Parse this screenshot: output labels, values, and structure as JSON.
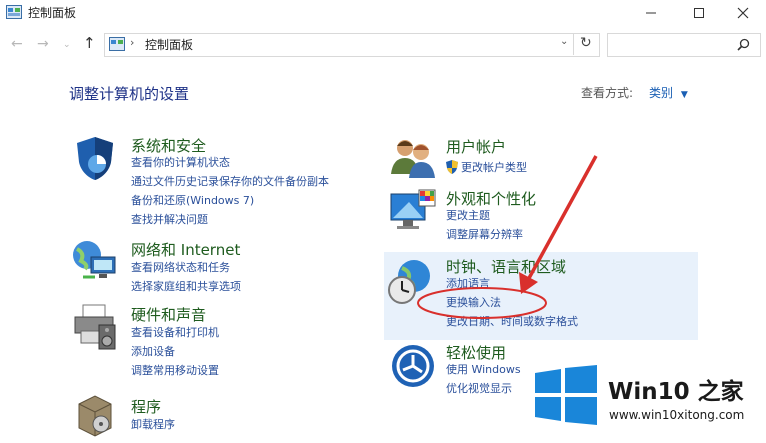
{
  "window": {
    "title": "控制面板"
  },
  "address": {
    "path": "控制面板",
    "search_placeholder": ""
  },
  "main": {
    "heading": "调整计算机的设置",
    "view_by_label": "查看方式:",
    "view_by_value": "类别"
  },
  "categories": [
    {
      "title": "系统和安全",
      "icon": "shield-icon",
      "links": [
        "查看你的计算机状态",
        "通过文件历史记录保存你的文件备份副本",
        "备份和还原(Windows 7)",
        "查找并解决问题"
      ]
    },
    {
      "title": "网络和 Internet",
      "icon": "network-globe-icon",
      "links": [
        "查看网络状态和任务",
        "选择家庭组和共享选项"
      ]
    },
    {
      "title": "硬件和声音",
      "icon": "printer-icon",
      "links": [
        "查看设备和打印机",
        "添加设备",
        "调整常用移动设置"
      ]
    },
    {
      "title": "程序",
      "icon": "programs-box-icon",
      "links": [
        "卸载程序"
      ]
    },
    {
      "title": "用户帐户",
      "icon": "users-icon",
      "links": [
        "更改帐户类型"
      ]
    },
    {
      "title": "外观和个性化",
      "icon": "monitor-palette-icon",
      "links": [
        "更改主题",
        "调整屏幕分辨率"
      ]
    },
    {
      "title": "时钟、语言和区域",
      "icon": "clock-globe-icon",
      "links": [
        "添加语言",
        "更换输入法",
        "更改日期、时间或数字格式"
      ]
    },
    {
      "title": "轻松使用",
      "icon": "ease-of-access-icon",
      "links": [
        "使用 Windows",
        "优化视觉显示"
      ]
    }
  ],
  "watermark": {
    "title": "Win10 之家",
    "url": "www.win10xitong.com"
  },
  "colors": {
    "accent": "#1a5fb4",
    "link": "#2a4f9a",
    "annotation": "#d9302c",
    "highlight": "#e8f1fb"
  }
}
